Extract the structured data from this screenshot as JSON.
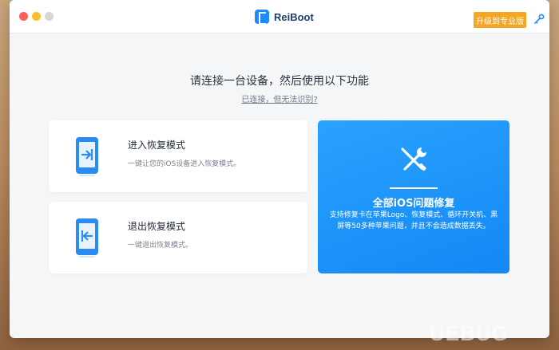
{
  "app": {
    "name": "ReiBoot",
    "upgrade_label": "升级到专业版",
    "key_icon": "key-icon"
  },
  "main": {
    "headline": "请连接一台设备，然后使用以下功能",
    "connection_help": "已连接，但无法识别?"
  },
  "cards": {
    "enter_recovery": {
      "title": "进入恢复模式",
      "description": "一键让您的iOS设备进入恢复模式。",
      "icon": "phone-enter-icon"
    },
    "exit_recovery": {
      "title": "退出恢复模式",
      "description": "一键退出恢复模式。",
      "icon": "phone-exit-icon"
    },
    "repair": {
      "title": "全部iOS问题修复",
      "description": "支持修复卡在苹果Logo、恢复模式、循环开关机、黑屏等50多种苹果问题，并且不会造成数据丢失。",
      "icon": "tools-icon"
    }
  },
  "watermark": "UEBUG",
  "colors": {
    "accent": "#1a8cff",
    "upgrade": "#f5a623",
    "repair_card": "#1e96fa"
  }
}
